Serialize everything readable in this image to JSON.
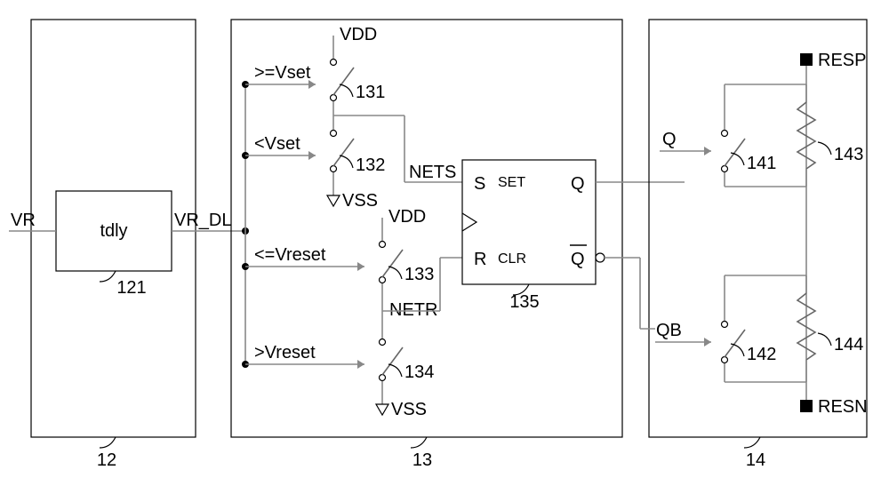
{
  "block12": {
    "ref": "12",
    "tdly_label": "tdly",
    "tdly_ref": "121",
    "in": "VR",
    "out": "VR_DL"
  },
  "block13": {
    "ref": "13",
    "vdd1": "VDD",
    "vdd2": "VDD",
    "vss1": "VSS",
    "vss2": "VSS",
    "cond1": ">=Vset",
    "cond2": "<Vset",
    "cond3": "<=Vreset",
    "cond4": ">Vreset",
    "sw1": "131",
    "sw2": "132",
    "sw3": "133",
    "sw4": "134",
    "nets": "NETS",
    "netr": "NETR",
    "latch": {
      "S": "S",
      "set": "SET",
      "Q": "Q",
      "R": "R",
      "clr": "CLR",
      "Qb": "Q",
      "ref": "135"
    }
  },
  "block14": {
    "ref": "14",
    "q": "Q",
    "qb": "QB",
    "sw141": "141",
    "sw142": "142",
    "r143": "143",
    "r144": "144",
    "resp": "RESP",
    "resn": "RESN"
  }
}
